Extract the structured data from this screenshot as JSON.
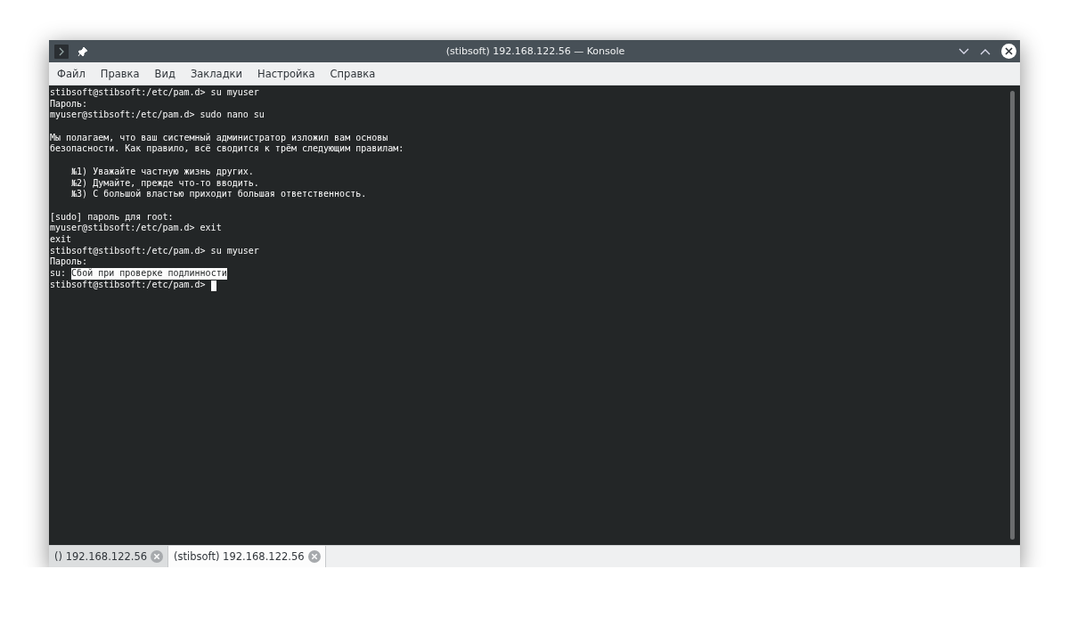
{
  "window": {
    "title": "(stibsoft) 192.168.122.56 — Konsole"
  },
  "menu": [
    "Файл",
    "Правка",
    "Вид",
    "Закладки",
    "Настройка",
    "Справка"
  ],
  "terminal": {
    "lines": [
      {
        "kind": "text",
        "segments": [
          {
            "text": "stibsoft@stibsoft:/etc/pam.d> su myuser",
            "selected": false
          }
        ]
      },
      {
        "kind": "text",
        "segments": [
          {
            "text": "Пароль:",
            "selected": false
          }
        ]
      },
      {
        "kind": "text",
        "segments": [
          {
            "text": "myuser@stibsoft:/etc/pam.d> sudo nano su",
            "selected": false
          }
        ]
      },
      {
        "kind": "blank"
      },
      {
        "kind": "text",
        "segments": [
          {
            "text": "Мы полагаем, что ваш системный администратор изложил вам основы",
            "selected": false
          }
        ]
      },
      {
        "kind": "text",
        "segments": [
          {
            "text": "безопасности. Как правило, всё сводится к трём следующим правилам:",
            "selected": false
          }
        ]
      },
      {
        "kind": "blank"
      },
      {
        "kind": "text",
        "segments": [
          {
            "text": "    №1) Уважайте частную жизнь других.",
            "selected": false
          }
        ]
      },
      {
        "kind": "text",
        "segments": [
          {
            "text": "    №2) Думайте, прежде что-то вводить.",
            "selected": false
          }
        ]
      },
      {
        "kind": "text",
        "segments": [
          {
            "text": "    №3) С большой властью приходит большая ответственность.",
            "selected": false
          }
        ]
      },
      {
        "kind": "blank"
      },
      {
        "kind": "text",
        "segments": [
          {
            "text": "[sudo] пароль для root:",
            "selected": false
          }
        ]
      },
      {
        "kind": "text",
        "segments": [
          {
            "text": "myuser@stibsoft:/etc/pam.d> exit",
            "selected": false
          }
        ]
      },
      {
        "kind": "text",
        "segments": [
          {
            "text": "exit",
            "selected": false
          }
        ]
      },
      {
        "kind": "text",
        "segments": [
          {
            "text": "stibsoft@stibsoft:/etc/pam.d> su myuser",
            "selected": false
          }
        ]
      },
      {
        "kind": "text",
        "segments": [
          {
            "text": "Пароль:",
            "selected": false
          }
        ]
      },
      {
        "kind": "text",
        "segments": [
          {
            "text": "su: ",
            "selected": false
          },
          {
            "text": "Сбой при проверке подлинности",
            "selected": true
          }
        ]
      },
      {
        "kind": "text",
        "cursor": true,
        "segments": [
          {
            "text": "stibsoft@stibsoft:/etc/pam.d> ",
            "selected": false
          }
        ]
      }
    ]
  },
  "tabs": [
    {
      "label": "() 192.168.122.56",
      "selected": false
    },
    {
      "label": "(stibsoft) 192.168.122.56",
      "selected": true
    }
  ]
}
